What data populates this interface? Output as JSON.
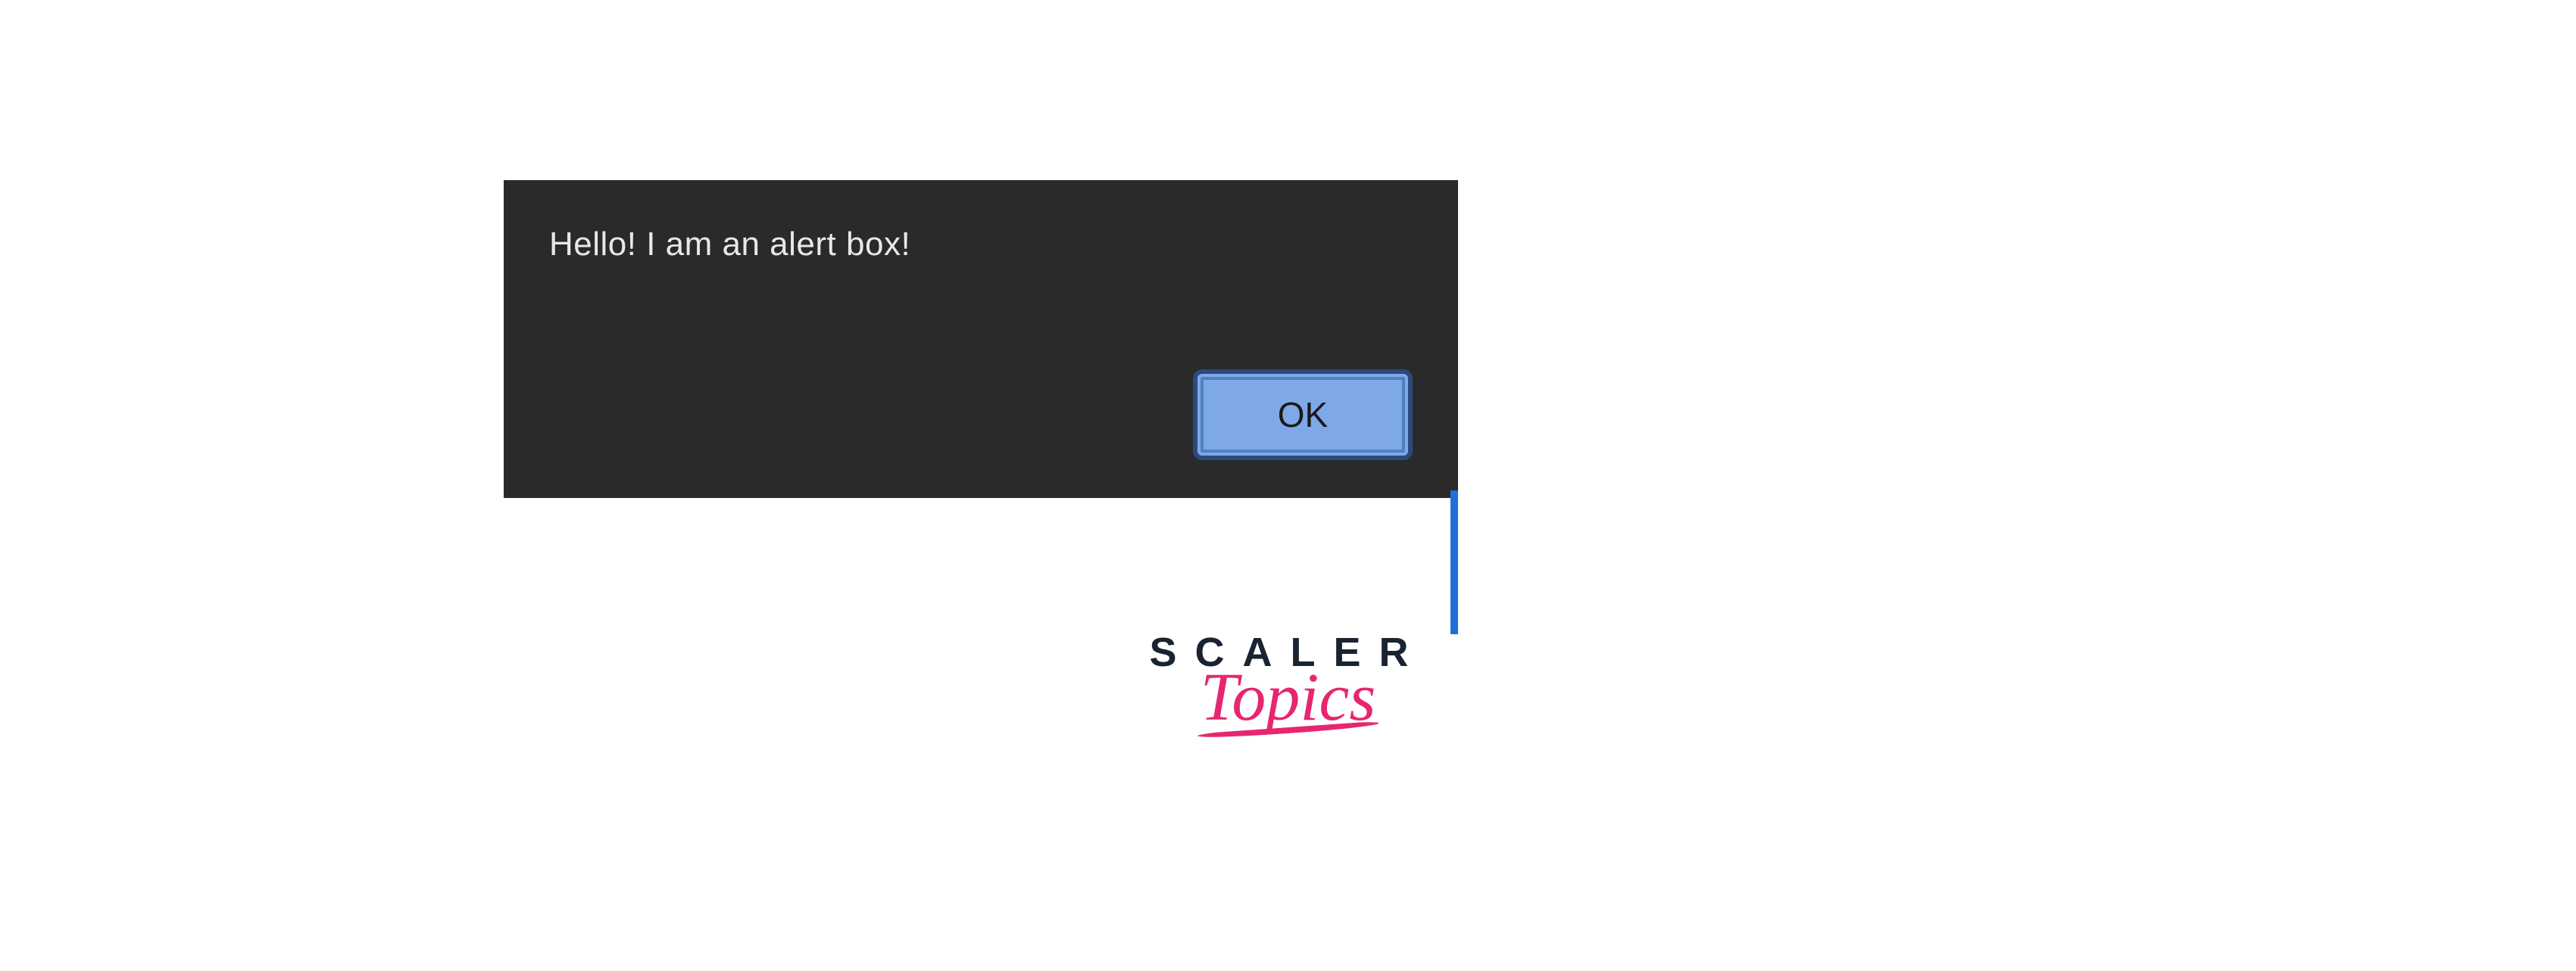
{
  "alert": {
    "message": "Hello! I am an alert box!",
    "ok_label": "OK"
  },
  "logo": {
    "line1": "SCALER",
    "line2": "Topics"
  },
  "colors": {
    "dialog_bg": "#2a2a2a",
    "button_bg": "#7fa8e8",
    "accent": "#e6276f"
  }
}
